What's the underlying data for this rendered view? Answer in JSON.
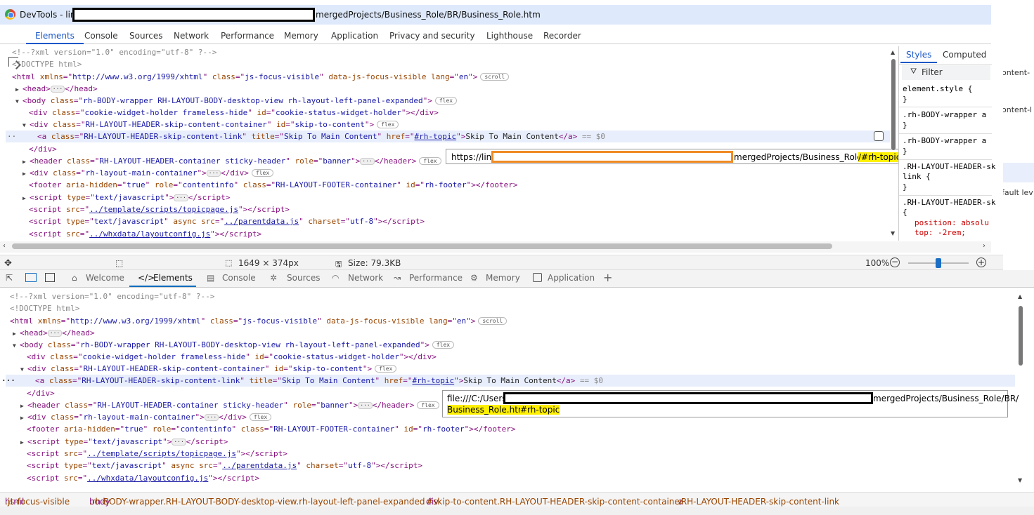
{
  "window": {
    "title_prefix": "DevTools - lin",
    "title_suffix": "mergedProjects/Business_Role/BR/Business_Role.htm"
  },
  "top_tabs": [
    "Elements",
    "Console",
    "Sources",
    "Network",
    "Performance",
    "Memory",
    "Application",
    "Privacy and security",
    "Lighthouse",
    "Recorder"
  ],
  "dom1": {
    "l1": "<!--?xml version=\"1.0\" encoding=\"utf-8\" ?-->",
    "l2": "<!DOCTYPE html>",
    "selected_marker": "== $0",
    "scroll_badge": "scroll",
    "flex_badge": "flex"
  },
  "tooltip1": {
    "prefix": "https://lin-",
    "middle": "mergedProjects/Business_Role/BR/",
    "highlight": "/#rh-topic"
  },
  "tooltip2": {
    "prefix": "file:///C:/Users",
    "middle": "mergedProjects/Business_Role/BR/",
    "highlight_file": "Business_Role.htm",
    "highlight_hash": "#rh-topic"
  },
  "styles_panel": {
    "tabs": [
      "Styles",
      "Computed"
    ],
    "filter_placeholder": "Filter",
    "lines": [
      "element.style {",
      "}",
      ".rh-BODY-wrapper a",
      ".rh-BODY-wrapper a",
      ".RH-LAYOUT-HEADER-sk",
      "link {",
      "}",
      ".RH-LAYOUT-HEADER-sk",
      "{",
      "position: absolu",
      "top: -2rem;"
    ]
  },
  "status_strip": {
    "dimensions": "1649 × 374px",
    "size": "Size: 79.3KB",
    "zoom": "100%",
    "zoom_level": 0.5
  },
  "bottom_tabs": [
    "Welcome",
    "Elements",
    "Console",
    "Sources",
    "Network",
    "Performance",
    "Memory",
    "Application"
  ],
  "breadcrumbs": [
    {
      "tag": "html",
      "cls": ".js-focus-visible"
    },
    {
      "tag": "body",
      "cls": ".rh-BODY-wrapper.RH-LAYOUT-BODY-desktop-view.rh-layout-left-panel-expanded"
    },
    {
      "tag": "div",
      "cls": "#skip-to-content.RH-LAYOUT-HEADER-skip-content-container"
    },
    {
      "tag": "a",
      "cls": ".RH-LAYOUT-HEADER-skip-content-link"
    }
  ],
  "right_fragments": [
    "ontent-",
    "ontent-l",
    "fault lev"
  ]
}
